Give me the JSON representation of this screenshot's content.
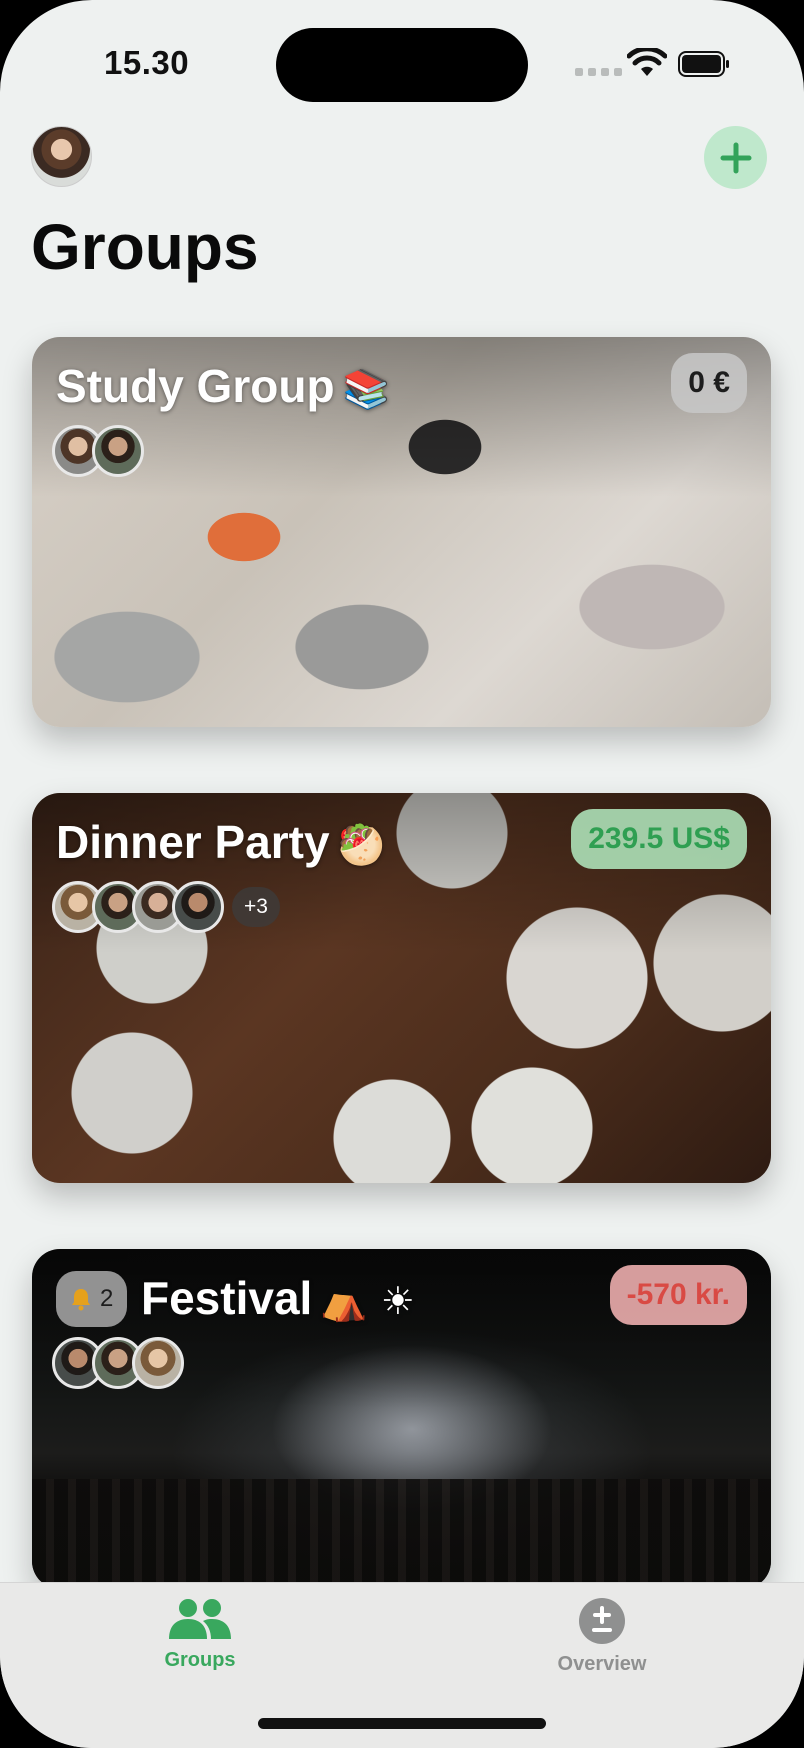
{
  "status_bar": {
    "time": "15.30"
  },
  "header": {
    "title": "Groups"
  },
  "groups": [
    {
      "name": "Study Group",
      "emoji": "📚",
      "amount": "0 €",
      "amount_state": "neutral",
      "members_extra": ""
    },
    {
      "name": "Dinner Party",
      "emoji": "🥙",
      "amount": "239.5 US$",
      "amount_state": "positive",
      "members_extra": "+3"
    },
    {
      "name": "Festival",
      "emoji": "⛺ ☀",
      "amount": "-570 kr.",
      "amount_state": "negative",
      "notifications": "2"
    }
  ],
  "tabbar": {
    "tabs": [
      {
        "label": "Groups",
        "icon": "people-icon",
        "active": true
      },
      {
        "label": "Overview",
        "icon": "plus-minus-icon",
        "active": false
      }
    ]
  },
  "colors": {
    "accent": "#39a85e",
    "positive": "#2f9f52",
    "negative": "#d94a44"
  }
}
